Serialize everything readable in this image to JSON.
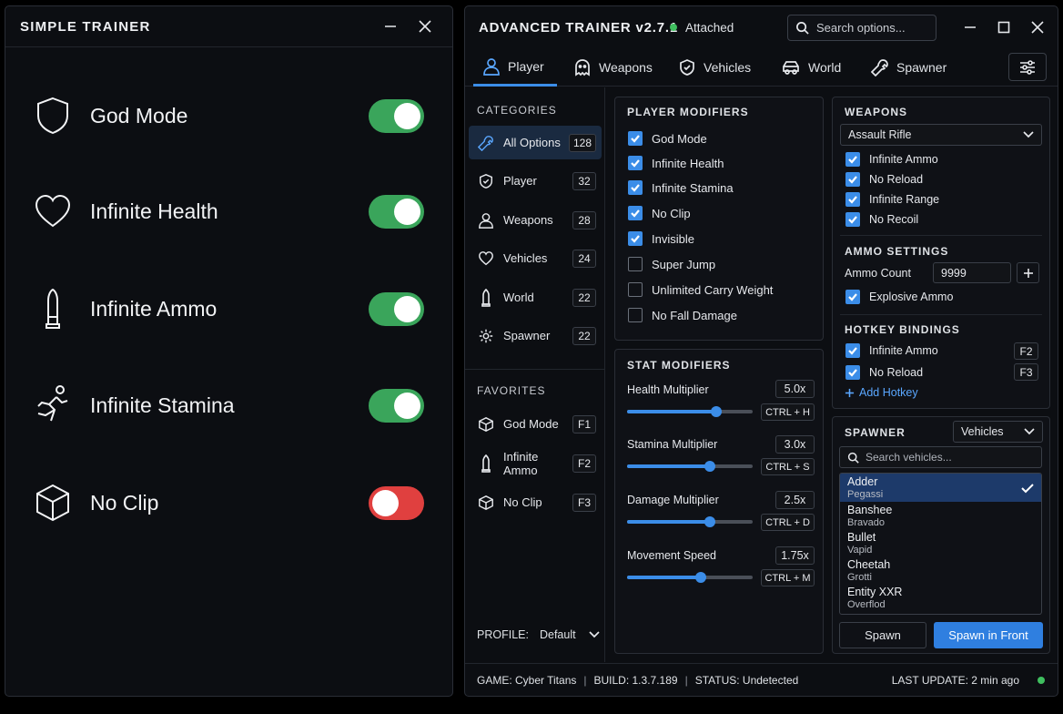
{
  "simple": {
    "title": "SIMPLE TRAINER",
    "items": [
      {
        "label": "God Mode",
        "icon": "shield-icon",
        "state": "on"
      },
      {
        "label": "Infinite Health",
        "icon": "heart-icon",
        "state": "on"
      },
      {
        "label": "Infinite Ammo",
        "icon": "bullet-icon",
        "state": "on"
      },
      {
        "label": "Infinite Stamina",
        "icon": "running-icon",
        "state": "on"
      },
      {
        "label": "No Clip",
        "icon": "cube-icon",
        "state": "off"
      }
    ]
  },
  "advanced": {
    "title": "ADVANCED TRAINER v2.7.1",
    "status": "Attached",
    "search_placeholder": "Search options...",
    "tabs": [
      {
        "label": "Player",
        "icon": "user-icon",
        "active": true
      },
      {
        "label": "Weapons",
        "icon": "ghost-icon",
        "active": false
      },
      {
        "label": "Vehicles",
        "icon": "shield-icon",
        "active": false
      },
      {
        "label": "World",
        "icon": "vehicle-icon",
        "active": false
      },
      {
        "label": "Spawner",
        "icon": "wrench-icon",
        "active": false
      }
    ],
    "sidebar": {
      "categories_title": "CATEGORIES",
      "categories": [
        {
          "label": "All Options",
          "count": "128",
          "icon": "wrench-icon"
        },
        {
          "label": "Player",
          "count": "32",
          "icon": "shield-icon"
        },
        {
          "label": "Weapons",
          "count": "28",
          "icon": "user-icon"
        },
        {
          "label": "Vehicles",
          "count": "24",
          "icon": "heart-icon"
        },
        {
          "label": "World",
          "count": "22",
          "icon": "bullet-icon"
        },
        {
          "label": "Spawner",
          "count": "22",
          "icon": "spawner-icon"
        }
      ],
      "favorites_title": "FAVORITES",
      "favorites": [
        {
          "label": "God Mode",
          "key": "F1",
          "icon": "cube-icon"
        },
        {
          "label": "Infinite Ammo",
          "key": "F2",
          "icon": "bullet-icon"
        },
        {
          "label": "No Clip",
          "key": "F3",
          "icon": "cube-icon"
        }
      ],
      "profile_label": "PROFILE:",
      "profile_value": "Default"
    },
    "player_modifiers": {
      "title": "PLAYER MODIFIERS",
      "items": [
        {
          "label": "God Mode",
          "checked": true
        },
        {
          "label": "Infinite Health",
          "checked": true
        },
        {
          "label": "Infinite Stamina",
          "checked": true
        },
        {
          "label": "No Clip",
          "checked": true
        },
        {
          "label": "Invisible",
          "checked": true
        },
        {
          "label": "Super Jump",
          "checked": false
        },
        {
          "label": "Unlimited Carry Weight",
          "checked": false
        },
        {
          "label": "No Fall Damage",
          "checked": false
        }
      ]
    },
    "stat_modifiers": {
      "title": "STAT MODIFIERS",
      "items": [
        {
          "label": "Health Multiplier",
          "value": "5.0x",
          "hotkey": "CTRL + H",
          "level": 0.71
        },
        {
          "label": "Stamina Multiplier",
          "value": "3.0x",
          "hotkey": "CTRL + S",
          "level": 0.66
        },
        {
          "label": "Damage Multiplier",
          "value": "2.5x",
          "hotkey": "CTRL + D",
          "level": 0.66
        },
        {
          "label": "Movement Speed",
          "value": "1.75x",
          "hotkey": "CTRL + M",
          "level": 0.59
        }
      ]
    },
    "weapons": {
      "title": "WEAPONS",
      "selected": "Assault Rifle",
      "items": [
        {
          "label": "Infinite Ammo",
          "checked": true
        },
        {
          "label": "No Reload",
          "checked": true
        },
        {
          "label": "Infinite Range",
          "checked": true
        },
        {
          "label": "No Recoil",
          "checked": true
        }
      ],
      "ammo_title": "AMMO SETTINGS",
      "ammo_count_label": "Ammo Count",
      "ammo_count": "9999",
      "explosive_label": "Explosive Ammo",
      "hotkey_title": "HOTKEY BINDINGS",
      "hotkeys": [
        {
          "label": "Infinite Ammo",
          "key": "F2"
        },
        {
          "label": "No Reload",
          "key": "F3"
        }
      ],
      "add_hotkey": "Add Hotkey"
    },
    "spawner": {
      "title": "SPAWNER",
      "category": "Vehicles",
      "search_placeholder": "Search vehicles...",
      "vehicles": [
        {
          "name": "Adder",
          "brand": "Pegassi",
          "selected": true
        },
        {
          "name": "Banshee",
          "brand": "Bravado",
          "selected": false
        },
        {
          "name": "Bullet",
          "brand": "Vapid",
          "selected": false
        },
        {
          "name": "Cheetah",
          "brand": "Grotti",
          "selected": false
        },
        {
          "name": "Entity XXR",
          "brand": "Overflod",
          "selected": false
        }
      ],
      "spawn_label": "Spawn",
      "spawn_front_label": "Spawn in Front"
    },
    "statusbar": {
      "game": "GAME: Cyber Titans",
      "build": "BUILD: 1.3.7.189",
      "status": "STATUS: Undetected",
      "last_update": "LAST UPDATE: 2 min ago"
    }
  }
}
